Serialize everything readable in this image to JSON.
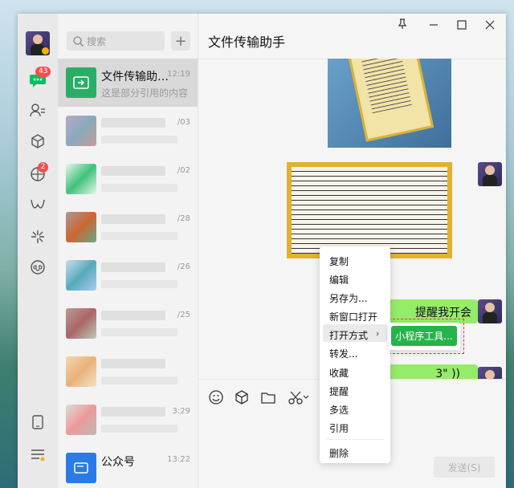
{
  "nav": {
    "chat_badge": "43",
    "moments_badge": "2"
  },
  "search": {
    "placeholder": "搜索"
  },
  "conversations": [
    {
      "title": "文件传输助…",
      "time": "12:19",
      "subtitle": "这是部分引用的内容"
    },
    {
      "time": "/03"
    },
    {
      "time": "/02"
    },
    {
      "time": "/28"
    },
    {
      "time": "/26"
    },
    {
      "time": "/25"
    },
    {
      "time": ""
    },
    {
      "time": "3:29"
    },
    {
      "title": "公众号",
      "time": "13:22"
    }
  ],
  "chat": {
    "title": "文件传输助手",
    "bubble1": "提醒我开会",
    "bubble2": "3\" ))",
    "send_label": "发送(S)"
  },
  "context_menu": {
    "items": [
      "复制",
      "编辑",
      "另存为...",
      "新窗口打开",
      "打开方式",
      "转发...",
      "收藏",
      "提醒",
      "多选",
      "引用",
      "删除"
    ]
  },
  "submenu": {
    "item": "小程序工具..."
  },
  "colors": {
    "accent": "#07c160",
    "bubble": "#95ec69",
    "badge": "#f54e4e"
  }
}
